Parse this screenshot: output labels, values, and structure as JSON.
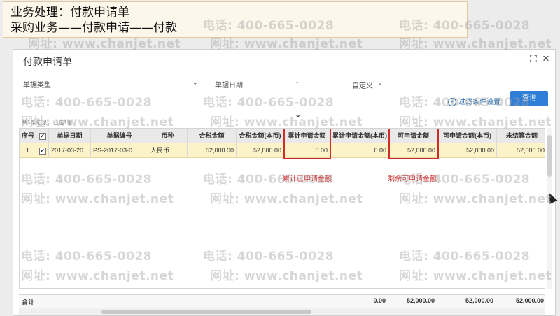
{
  "banner": {
    "line1": "业务处理：付款申请单",
    "line2": "采购业务——付款申请——付款"
  },
  "dialog": {
    "title": "付款申请单",
    "maximize_icon": "⛶",
    "close_icon": "×"
  },
  "filter": {
    "doc_type_label": "单据类型",
    "doc_date_label": "单据日期",
    "date_separator": "-",
    "range_value": "自定义",
    "settings_label": "过滤条件设置",
    "query_label": "查询",
    "collapse_icon": "chevrons-down",
    "record_info": "共1条记录，已选1条"
  },
  "table": {
    "columns": [
      "序号",
      "",
      "单据日期",
      "单据编号",
      "币种",
      "合税金额",
      "合税金额(本币)",
      "累计申请金额",
      "累计申请金额(本币)",
      "可申请金额",
      "可申请金额(本币)",
      "未结算金额"
    ],
    "rows": [
      {
        "seq": "1",
        "checked": "✔",
        "date": "2017-03-20",
        "number": "PS-2017-03-0...",
        "currency": "人民币",
        "amount_tax": "52,000.00",
        "amount_tax_local": "52,000.00",
        "cum_applied": "0.00",
        "cum_applied_local": "0.00",
        "applicable": "52,000.00",
        "applicable_local": "52,000.00",
        "unsettled": "52,000.00"
      }
    ]
  },
  "annotations": {
    "cum_applied_note": "累计已申请金额",
    "remaining_note": "剩余可申请金额",
    "highlight_color": "#d12b2b"
  },
  "footer": {
    "total_label": "合计",
    "cum_applied_local_total": "0.00",
    "applicable_total": "52,000.00",
    "applicable_local_total": "52,000.00",
    "unsettled_total": "52,000.00"
  },
  "watermark": {
    "phone": "电话: 400-665-0028",
    "site": "网址: www.chanjet.net"
  },
  "colors": {
    "accent": "#2f7fd8",
    "selected_row": "#fdf3c8",
    "banner_bg": "#fdf6ea"
  }
}
